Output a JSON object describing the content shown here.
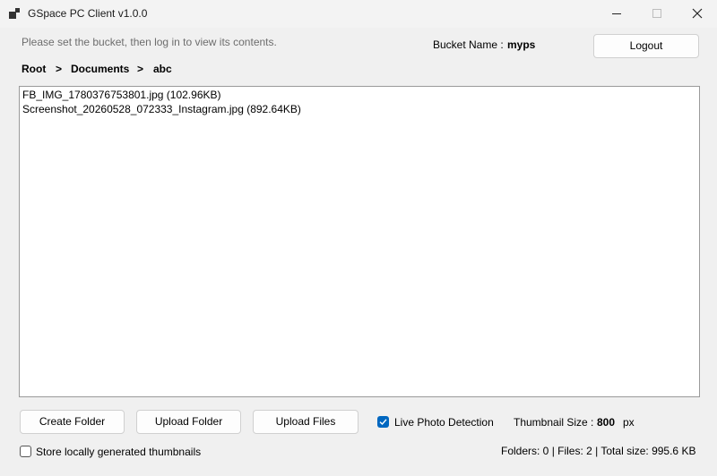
{
  "window": {
    "title": "GSpace PC Client v1.0.0",
    "icon": "app-grid-icon"
  },
  "header": {
    "hint": "Please set the bucket, then log in to view its contents.",
    "bucket_label": "Bucket Name :",
    "bucket_value": "myps",
    "logout_label": "Logout"
  },
  "breadcrumb": {
    "items": [
      "Root",
      ">",
      "Documents",
      ">",
      "abc"
    ]
  },
  "files": [
    "FB_IMG_1780376753801.jpg (102.96KB)",
    "Screenshot_20260528_072333_Instagram.jpg (892.64KB)"
  ],
  "actions": {
    "create_folder": "Create Folder",
    "upload_folder": "Upload Folder",
    "upload_files": "Upload Files"
  },
  "options": {
    "live_photo_label": "Live Photo Detection",
    "live_photo_checked": true,
    "thumbnail_label": "Thumbnail Size :",
    "thumbnail_value": "800",
    "thumbnail_unit": "px",
    "store_thumbnails_label": "Store locally generated thumbnails",
    "store_thumbnails_checked": false
  },
  "status": {
    "summary": "Folders: 0 | Files: 2 | Total size: 995.6 KB"
  },
  "colors": {
    "accent": "#0067c0",
    "window_bg": "#f0f0f0"
  }
}
